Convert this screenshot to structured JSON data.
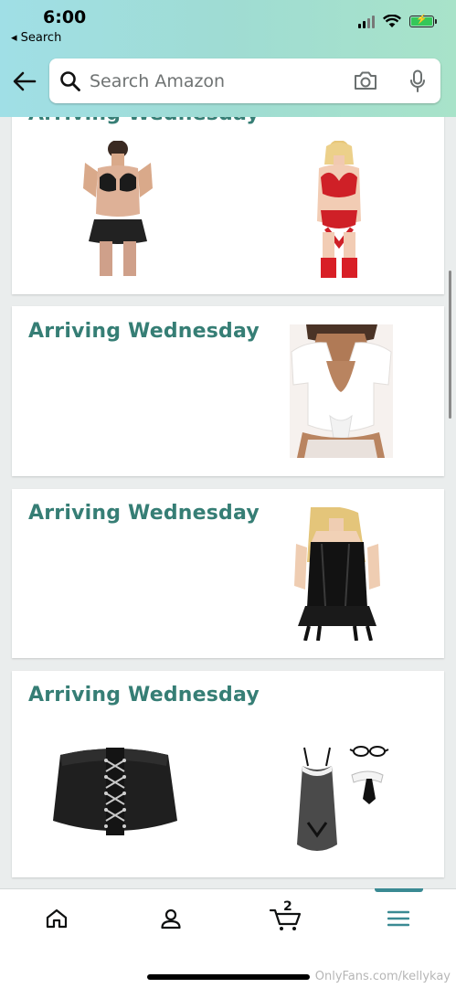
{
  "status_bar": {
    "time": "6:00",
    "back_app": "◂ Search"
  },
  "search": {
    "placeholder": "Search Amazon"
  },
  "deliveries": [
    {
      "title": "Arriving Wednesday",
      "items": [
        "lingerie-bikini-set-black",
        "lingerie-set-red-lace"
      ]
    },
    {
      "title": "Arriving Wednesday",
      "items": [
        "white-tie-front-crop-top"
      ]
    },
    {
      "title": "Arriving Wednesday",
      "items": [
        "black-leather-corset-dress"
      ]
    },
    {
      "title": "Arriving Wednesday",
      "items": [
        "black-waist-corset-belt",
        "black-sheer-costume-dress"
      ]
    }
  ],
  "bottom_nav": {
    "cart_count": "2",
    "active_tab": "menu"
  },
  "watermark": "OnlyFans.com/kellykay",
  "colors": {
    "accent": "#367e75",
    "nav_indicator": "#3a8a93"
  }
}
